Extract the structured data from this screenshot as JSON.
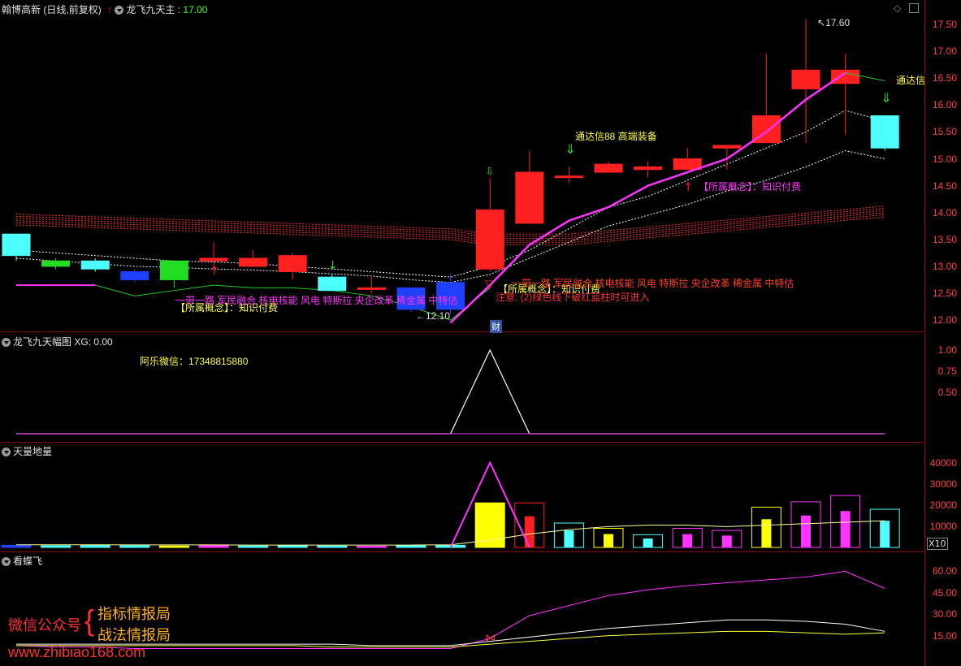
{
  "main_panel": {
    "stock_name": "翰博高新",
    "period": "(日线,前复权)",
    "indicator_name": "龙飞九天主",
    "indicator_value": "17.00",
    "y_ticks": [
      "17.50",
      "17.00",
      "16.50",
      "16.00",
      "15.50",
      "15.00",
      "14.50",
      "14.00",
      "13.50",
      "13.00",
      "12.50",
      "12.00"
    ],
    "high_label": "17.60",
    "low_label": "12.10",
    "tags": {
      "tdx_88": "通达信88 高端装备",
      "tdx_right": "通达信",
      "concept_1": "【所属概念】：知识付费",
      "concept_2": "【所属概念】：知识付费",
      "concept_3": "【所属概念】：知识付费",
      "sectors_1": "一带一路 军民融合 核电核能 风电 特斯拉 央企改革 稀金属 中特估",
      "sectors_2": "一带一路 军民融合 核电核能 风电 特斯拉 央企改革 稀金属 中特估",
      "note": "注意: (2)绿色线下破红蓝柱时可进入",
      "cai": "财"
    },
    "colors": {
      "up": "#ff2020",
      "down": "#4dffff",
      "ma_main": "#ff33ff",
      "dotted": "#ffffff",
      "red_band": "#ff3030"
    }
  },
  "range_panel": {
    "title": "龙飞九天幅图",
    "label": "XG:",
    "value": "0.00",
    "contact": "阿乐微信：17348815880",
    "y_ticks": [
      "1.00",
      "0.75",
      "0.50"
    ]
  },
  "volume_panel": {
    "title": "天量地量",
    "y_ticks": [
      "40000",
      "30000",
      "20000",
      "10000"
    ],
    "unit": "X10"
  },
  "butterfly_panel": {
    "title": "看蝶飞",
    "y_ticks": [
      "60.00",
      "45.00",
      "30.00",
      "15.00"
    ]
  },
  "watermark": {
    "wechat_label": "微信公众号",
    "brand_1": "指标情报局",
    "brand_2": "战法情报局",
    "url": "www.zhibiao168.com"
  },
  "chart_data": {
    "type": "candlestick",
    "ylim": [
      11.9,
      17.9
    ],
    "candles": [
      {
        "open": 13.2,
        "close": 13.6,
        "high": 13.6,
        "low": 13.1,
        "color": "cyan"
      },
      {
        "open": 13.0,
        "close": 13.1,
        "high": 13.15,
        "low": 12.95,
        "color": "green"
      },
      {
        "open": 13.1,
        "close": 12.95,
        "high": 13.15,
        "low": 12.9,
        "color": "cyan"
      },
      {
        "open": 12.9,
        "close": 12.75,
        "high": 12.95,
        "low": 12.7,
        "color": "blue"
      },
      {
        "open": 12.75,
        "close": 13.1,
        "high": 13.1,
        "low": 12.6,
        "color": "green"
      },
      {
        "open": 13.1,
        "close": 13.15,
        "high": 13.45,
        "low": 12.95,
        "color": "red"
      },
      {
        "open": 13.0,
        "close": 13.15,
        "high": 13.3,
        "low": 13.0,
        "color": "red"
      },
      {
        "open": 12.9,
        "close": 13.2,
        "high": 13.25,
        "low": 12.75,
        "color": "red"
      },
      {
        "open": 12.8,
        "close": 12.55,
        "high": 12.85,
        "low": 12.55,
        "color": "cyan"
      },
      {
        "open": 12.6,
        "close": 12.6,
        "high": 12.8,
        "low": 12.5,
        "color": "red"
      },
      {
        "open": 12.6,
        "close": 12.2,
        "high": 12.6,
        "low": 12.15,
        "color": "blue"
      },
      {
        "open": 12.2,
        "close": 12.7,
        "high": 12.85,
        "low": 12.1,
        "color": "blue"
      },
      {
        "open": 12.95,
        "close": 14.05,
        "high": 14.65,
        "low": 12.9,
        "color": "red"
      },
      {
        "open": 13.8,
        "close": 14.75,
        "high": 15.15,
        "low": 13.8,
        "color": "red"
      },
      {
        "open": 14.65,
        "close": 14.68,
        "high": 14.85,
        "low": 14.55,
        "color": "red"
      },
      {
        "open": 14.75,
        "close": 14.9,
        "high": 14.95,
        "low": 14.75,
        "color": "red"
      },
      {
        "open": 14.8,
        "close": 14.85,
        "high": 14.95,
        "low": 14.65,
        "color": "red"
      },
      {
        "open": 14.8,
        "close": 15.0,
        "high": 15.2,
        "low": 14.8,
        "color": "red"
      },
      {
        "open": 15.2,
        "close": 15.25,
        "high": 15.25,
        "low": 14.8,
        "color": "red"
      },
      {
        "open": 15.3,
        "close": 15.8,
        "high": 16.95,
        "low": 15.3,
        "color": "red"
      },
      {
        "open": 16.3,
        "close": 16.65,
        "high": 17.6,
        "low": 15.3,
        "color": "red"
      },
      {
        "open": 16.4,
        "close": 16.65,
        "high": 16.95,
        "low": 15.45,
        "color": "red"
      },
      {
        "open": 15.2,
        "close": 15.8,
        "high": 15.8,
        "low": 15.15,
        "color": "cyan"
      }
    ],
    "ma_main": [
      null,
      null,
      null,
      null,
      null,
      null,
      null,
      null,
      null,
      null,
      null,
      11.95,
      12.65,
      13.4,
      13.85,
      14.1,
      14.5,
      14.75,
      15.0,
      15.5,
      16.1,
      16.6,
      16.45
    ],
    "range_series": [
      0,
      0,
      0,
      0,
      0,
      0,
      0,
      0,
      0,
      0,
      0,
      0,
      1.0,
      0,
      0,
      0,
      0,
      0,
      0,
      0,
      0,
      0,
      0
    ],
    "volume": [
      1000,
      800,
      900,
      800,
      700,
      900,
      700,
      900,
      700,
      600,
      800,
      1000,
      21000,
      21000,
      11500,
      9000,
      6000,
      9000,
      8000,
      19000,
      21500,
      24500,
      18000
    ],
    "butterfly_magenta": [
      8,
      7,
      7,
      6,
      6,
      6,
      6,
      6,
      6,
      6,
      6,
      6,
      13,
      29,
      36,
      43,
      47,
      50,
      52,
      54,
      56,
      60,
      48
    ],
    "butterfly_white": [
      9,
      9,
      9,
      9,
      9,
      9,
      9,
      9,
      9,
      8,
      8,
      8,
      11,
      14,
      17,
      20,
      22,
      24,
      26,
      26,
      25,
      23,
      18
    ],
    "butterfly_yellow": [
      8,
      8,
      8,
      8,
      8,
      8,
      8,
      8,
      7,
      7,
      7,
      7,
      9,
      11,
      13,
      15,
      16,
      17,
      18,
      18,
      17,
      16,
      17
    ]
  }
}
